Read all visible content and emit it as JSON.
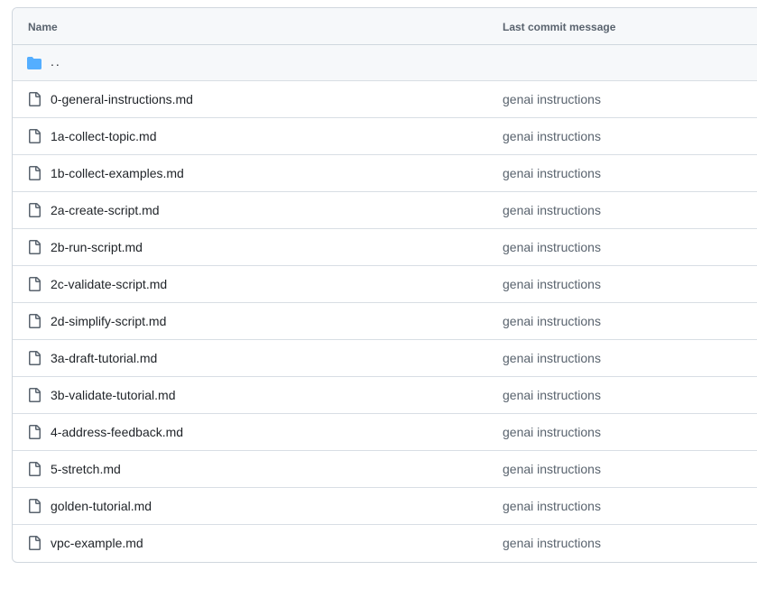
{
  "header": {
    "name_label": "Name",
    "commit_label": "Last commit message"
  },
  "parent_dir": {
    "label": "..",
    "icon": "folder-icon"
  },
  "files": [
    {
      "name": "0-general-instructions.md",
      "commit": "genai instructions",
      "icon": "file-icon"
    },
    {
      "name": "1a-collect-topic.md",
      "commit": "genai instructions",
      "icon": "file-icon"
    },
    {
      "name": "1b-collect-examples.md",
      "commit": "genai instructions",
      "icon": "file-icon"
    },
    {
      "name": "2a-create-script.md",
      "commit": "genai instructions",
      "icon": "file-icon"
    },
    {
      "name": "2b-run-script.md",
      "commit": "genai instructions",
      "icon": "file-icon"
    },
    {
      "name": "2c-validate-script.md",
      "commit": "genai instructions",
      "icon": "file-icon"
    },
    {
      "name": "2d-simplify-script.md",
      "commit": "genai instructions",
      "icon": "file-icon"
    },
    {
      "name": "3a-draft-tutorial.md",
      "commit": "genai instructions",
      "icon": "file-icon"
    },
    {
      "name": "3b-validate-tutorial.md",
      "commit": "genai instructions",
      "icon": "file-icon"
    },
    {
      "name": "4-address-feedback.md",
      "commit": "genai instructions",
      "icon": "file-icon"
    },
    {
      "name": "5-stretch.md",
      "commit": "genai instructions",
      "icon": "file-icon"
    },
    {
      "name": "golden-tutorial.md",
      "commit": "genai instructions",
      "icon": "file-icon"
    },
    {
      "name": "vpc-example.md",
      "commit": "genai instructions",
      "icon": "file-icon"
    }
  ],
  "colors": {
    "folder": "#54aeff",
    "file_icon": "#59636e",
    "text": "#1f2328",
    "muted": "#59636e",
    "border": "#d0d7de",
    "header_bg": "#f6f8fa"
  }
}
